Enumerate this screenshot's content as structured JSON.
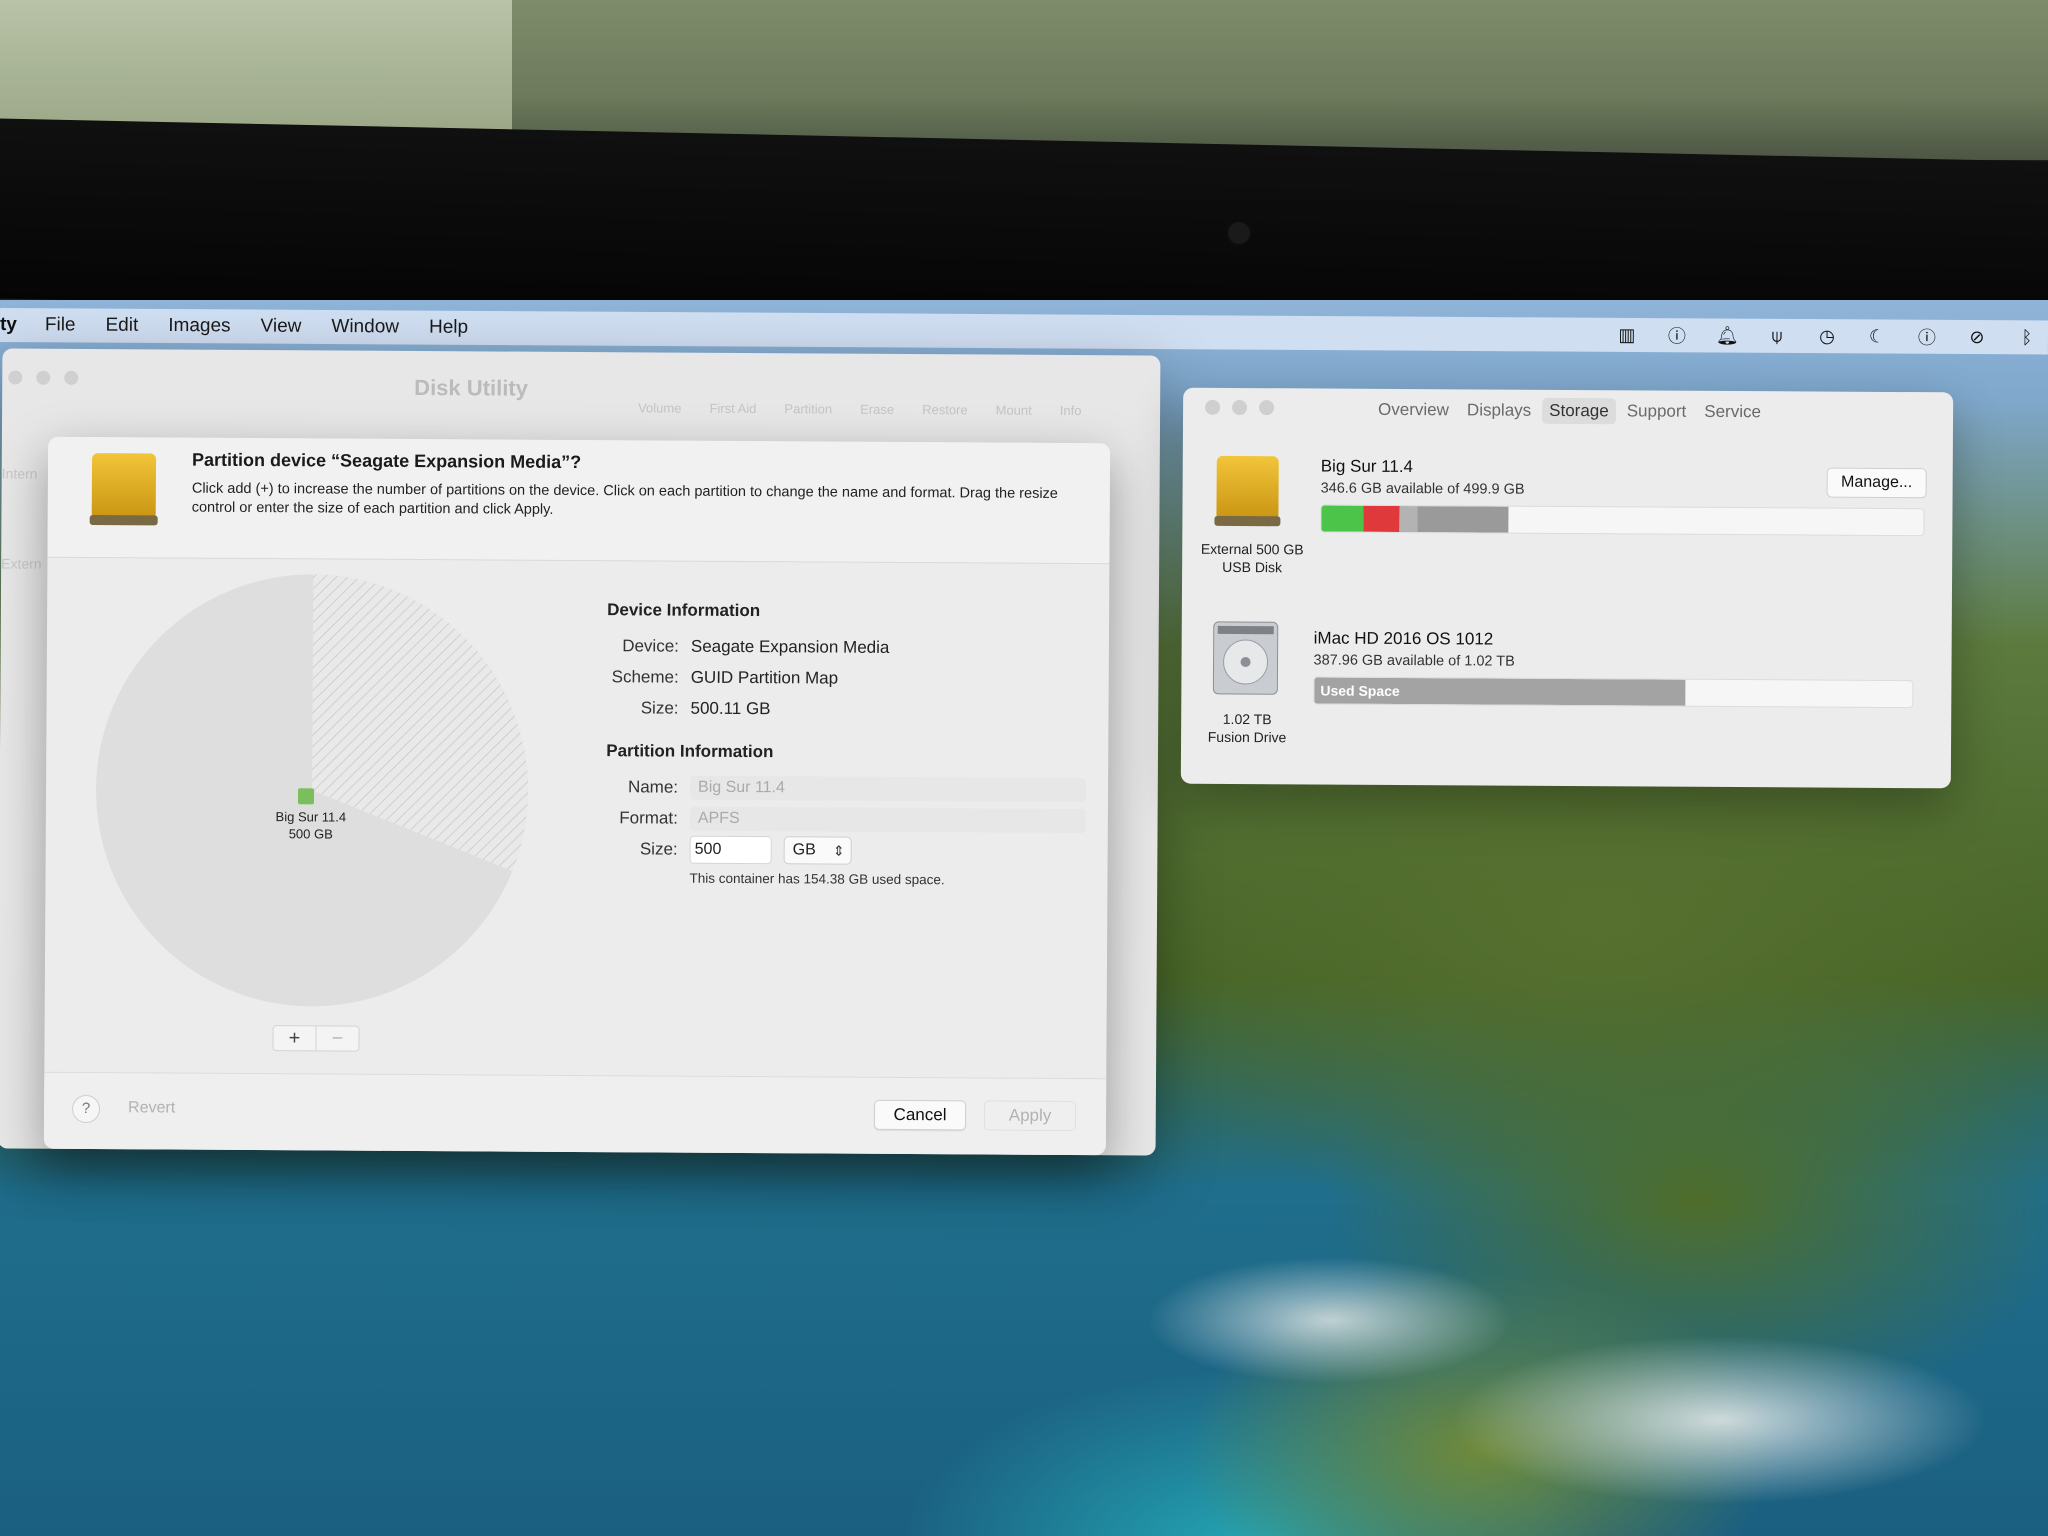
{
  "menubar": {
    "app_name": "ty",
    "items": [
      "File",
      "Edit",
      "Images",
      "View",
      "Window",
      "Help"
    ]
  },
  "status_icons": [
    "sidebar-icon",
    "info-icon",
    "bell-icon",
    "pin-icon",
    "clock-icon",
    "moon-icon",
    "info-icon",
    "mute-icon",
    "bluetooth-icon"
  ],
  "disk_utility": {
    "title": "Disk Utility",
    "toolbar": [
      "Volume",
      "First Aid",
      "Partition",
      "Erase",
      "Restore",
      "Mount"
    ],
    "info_label": "Info",
    "sidebar": [
      "Intern",
      "Extern"
    ]
  },
  "partition_sheet": {
    "title": "Partition device “Seagate Expansion Media”?",
    "description": "Click add (+) to increase the number of partitions on the device. Click on each partition to change the name and format. Drag the resize control or enter the size of each partition and click Apply.",
    "pie": {
      "partition_name": "Big Sur 11.4",
      "partition_size": "500 GB",
      "used_fraction": 0.31
    },
    "add_label": "+",
    "remove_label": "−",
    "device_info": {
      "heading": "Device Information",
      "device_label": "Device:",
      "device_value": "Seagate Expansion Media",
      "scheme_label": "Scheme:",
      "scheme_value": "GUID Partition Map",
      "size_label": "Size:",
      "size_value": "500.11 GB"
    },
    "partition_info": {
      "heading": "Partition Information",
      "name_label": "Name:",
      "name_value": "Big Sur 11.4",
      "format_label": "Format:",
      "format_value": "APFS",
      "size_label": "Size:",
      "size_value": "500",
      "size_unit": "GB",
      "note": "This container has 154.38 GB used space."
    },
    "footer": {
      "help": "?",
      "revert": "Revert",
      "cancel": "Cancel",
      "apply": "Apply"
    }
  },
  "about_mac": {
    "tabs": [
      "Overview",
      "Displays",
      "Storage",
      "Support",
      "Service"
    ],
    "active_tab": "Storage",
    "disks": [
      {
        "name": "Big Sur 11.4",
        "available": "346.6 GB available of 499.9 GB",
        "caption_line1": "External 500 GB",
        "caption_line2": "USB Disk",
        "manage": "Manage...",
        "segments": [
          {
            "color": "#4cc44a",
            "fraction": 0.07
          },
          {
            "color": "#e0393b",
            "fraction": 0.06
          },
          {
            "color": "#b3b3b3",
            "fraction": 0.03
          },
          {
            "color": "#9a9a9a",
            "fraction": 0.15
          }
        ]
      },
      {
        "name": "iMac HD 2016 OS 1012",
        "available": "387.96 GB available of 1.02 TB",
        "caption_line1": "1.02 TB",
        "caption_line2": "Fusion Drive",
        "used_label": "Used Space",
        "used_fraction": 0.62,
        "used_color": "#a3a3a3"
      }
    ]
  },
  "colors": {
    "drive_gold": "#e3b021",
    "accent_green": "#4cc44a",
    "accent_red": "#e0393b"
  }
}
